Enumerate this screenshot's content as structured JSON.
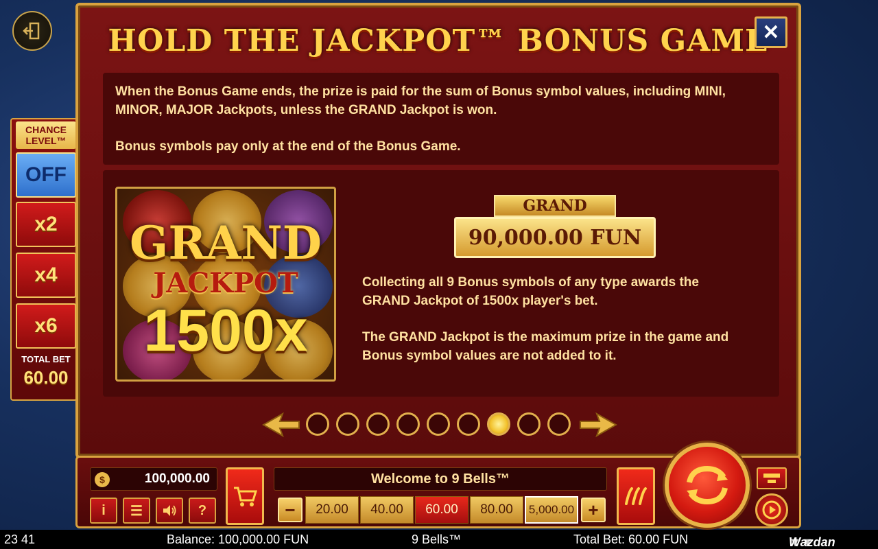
{
  "modal": {
    "title": "HOLD THE JACKPOT™ BONUS GAME",
    "close_icon": "close-icon",
    "text_paragraphs": [
      "When the Bonus Game ends, the prize is paid for the sum of Bonus symbol values, including MINI, MINOR, MAJOR Jackpots, unless the GRAND Jackpot is won.",
      "Bonus symbols pay only at the end of the Bonus Game."
    ],
    "jackpot_image": {
      "line1": "GRAND",
      "line2": "JACKPOT",
      "line3": "1500x"
    },
    "grand_label": "GRAND",
    "grand_value": "90,000.00 FUN",
    "feature_paragraphs": [
      "Collecting all 9 Bonus symbols of any type awards the GRAND Jackpot of 1500x player's bet.",
      "The GRAND Jackpot is the maximum prize in the game and Bonus symbol values are not added to it."
    ],
    "pager": {
      "total_pages": 9,
      "active_index": 6
    }
  },
  "chance_level": {
    "title": "CHANCE LEVEL™",
    "options": [
      "OFF",
      "x2",
      "x4",
      "x6"
    ],
    "total_bet_label": "TOTAL BET",
    "total_bet_value": "60.00"
  },
  "controls": {
    "balance": "100,000.00",
    "welcome": "Welcome to 9 Bells™",
    "bet_options": [
      "20.00",
      "40.00",
      "60.00",
      "80.00",
      "5,000.00"
    ],
    "selected_bet": "60.00",
    "minus": "−",
    "plus": "+",
    "small_buttons": [
      "i",
      "☰",
      "🔊",
      "?"
    ]
  },
  "status_bar": {
    "time": "23 41",
    "balance": "Balance: 100,000.00 FUN",
    "game": "9 Bells™",
    "total_bet": "Total Bet: 60.00 FUN",
    "brand": "Wazdan"
  },
  "colors": {
    "modal_bg": "#7c1414",
    "gold": "#d9a33f",
    "title_gold": "#ffd34d",
    "selected_bet": "#e8281b"
  }
}
